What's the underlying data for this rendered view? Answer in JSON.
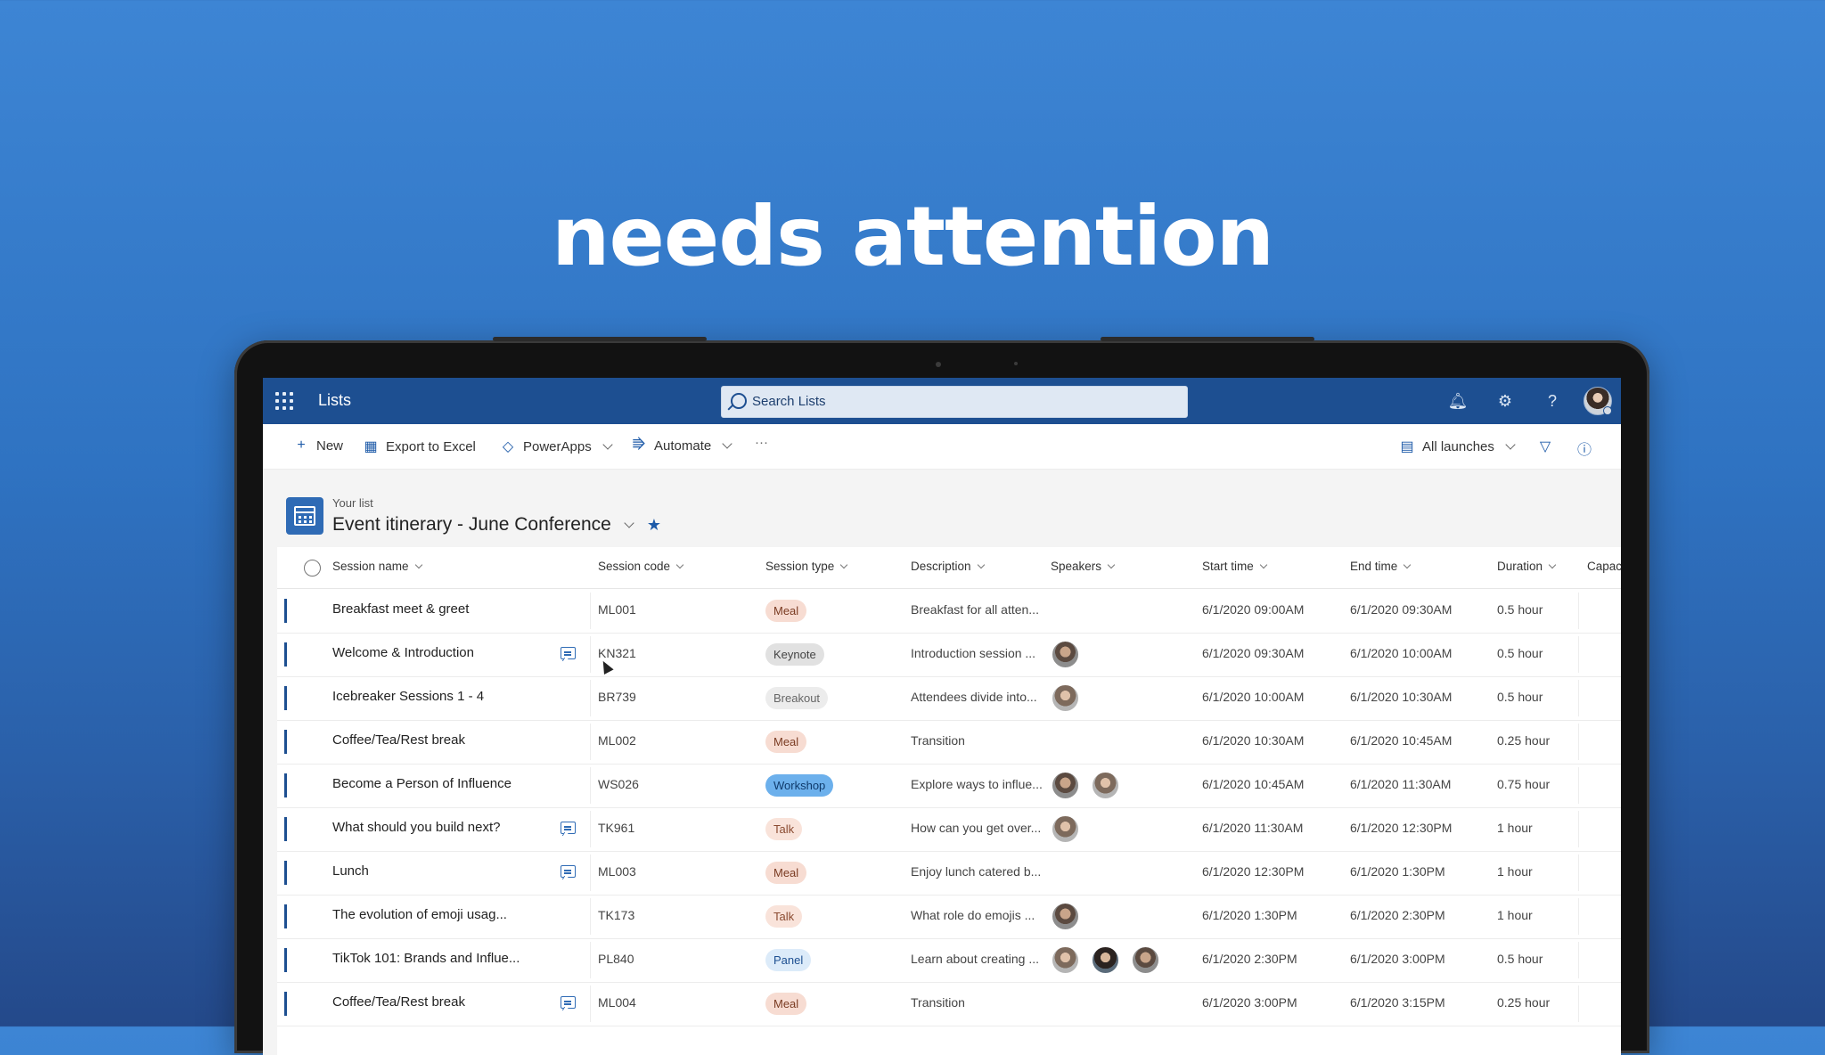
{
  "headline": "needs attention",
  "app": {
    "title": "Lists",
    "search_placeholder": "Search Lists"
  },
  "topbar_icons": [
    "bell-icon",
    "gear-icon",
    "help-icon"
  ],
  "commands": {
    "new": "New",
    "export": "Export to Excel",
    "powerapps": "PowerApps",
    "automate": "Automate",
    "more": "···",
    "view": "All launches"
  },
  "list": {
    "subtitle": "Your list",
    "title": "Event itinerary - June Conference"
  },
  "columns": {
    "name": "Session name",
    "code": "Session code",
    "type": "Session type",
    "desc": "Description",
    "speakers": "Speakers",
    "start": "Start time",
    "end": "End time",
    "duration": "Duration",
    "capacity": "Capacity"
  },
  "colors": {
    "accent": "#1d4f91",
    "meal": "#f7dcd2",
    "keynote": "#e1e1e1",
    "breakout": "#ececec",
    "workshop": "#6cb0ec",
    "talk": "#f9e3da",
    "panel": "#dcebf9"
  },
  "rows": [
    {
      "name": "Breakfast meet & greet",
      "comment": false,
      "code": "ML001",
      "type": "Meal",
      "desc": "Breakfast for all atten...",
      "speakers": 0,
      "start": "6/1/2020 09:00AM",
      "end": "6/1/2020 09:30AM",
      "duration": "0.5 hour"
    },
    {
      "name": "Welcome & Introduction",
      "comment": true,
      "code": "KN321",
      "type": "Keynote",
      "desc": "Introduction session ...",
      "speakers": 1,
      "start": "6/1/2020 09:30AM",
      "end": "6/1/2020 10:00AM",
      "duration": "0.5 hour"
    },
    {
      "name": "Icebreaker Sessions 1 - 4",
      "comment": false,
      "code": "BR739",
      "type": "Breakout",
      "desc": "Attendees divide into...",
      "speakers": 1,
      "start": "6/1/2020 10:00AM",
      "end": "6/1/2020 10:30AM",
      "duration": "0.5 hour"
    },
    {
      "name": "Coffee/Tea/Rest break",
      "comment": false,
      "code": "ML002",
      "type": "Meal",
      "desc": "Transition",
      "speakers": 0,
      "start": "6/1/2020 10:30AM",
      "end": "6/1/2020 10:45AM",
      "duration": "0.25 hour"
    },
    {
      "name": "Become a Person of Influence",
      "comment": false,
      "code": "WS026",
      "type": "Workshop",
      "desc": "Explore ways to influe...",
      "speakers": 2,
      "start": "6/1/2020 10:45AM",
      "end": "6/1/2020 11:30AM",
      "duration": "0.75 hour"
    },
    {
      "name": "What should you build next?",
      "comment": true,
      "code": "TK961",
      "type": "Talk",
      "desc": "How can you get over...",
      "speakers": 1,
      "start": "6/1/2020 11:30AM",
      "end": "6/1/2020 12:30PM",
      "duration": "1 hour"
    },
    {
      "name": "Lunch",
      "comment": true,
      "code": "ML003",
      "type": "Meal",
      "desc": "Enjoy lunch catered b...",
      "speakers": 0,
      "start": "6/1/2020 12:30PM",
      "end": "6/1/2020 1:30PM",
      "duration": "1 hour"
    },
    {
      "name": "The evolution of emoji usag...",
      "comment": false,
      "code": "TK173",
      "type": "Talk",
      "desc": "What role do emojis ...",
      "speakers": 1,
      "start": "6/1/2020 1:30PM",
      "end": "6/1/2020 2:30PM",
      "duration": "1 hour"
    },
    {
      "name": "TikTok 101: Brands and Influe...",
      "comment": false,
      "code": "PL840",
      "type": "Panel",
      "desc": "Learn about creating ...",
      "speakers": 3,
      "start": "6/1/2020 2:30PM",
      "end": "6/1/2020 3:00PM",
      "duration": "0.5 hour"
    },
    {
      "name": "Coffee/Tea/Rest break",
      "comment": true,
      "code": "ML004",
      "type": "Meal",
      "desc": "Transition",
      "speakers": 0,
      "start": "6/1/2020 3:00PM",
      "end": "6/1/2020 3:15PM",
      "duration": "0.25 hour"
    }
  ]
}
